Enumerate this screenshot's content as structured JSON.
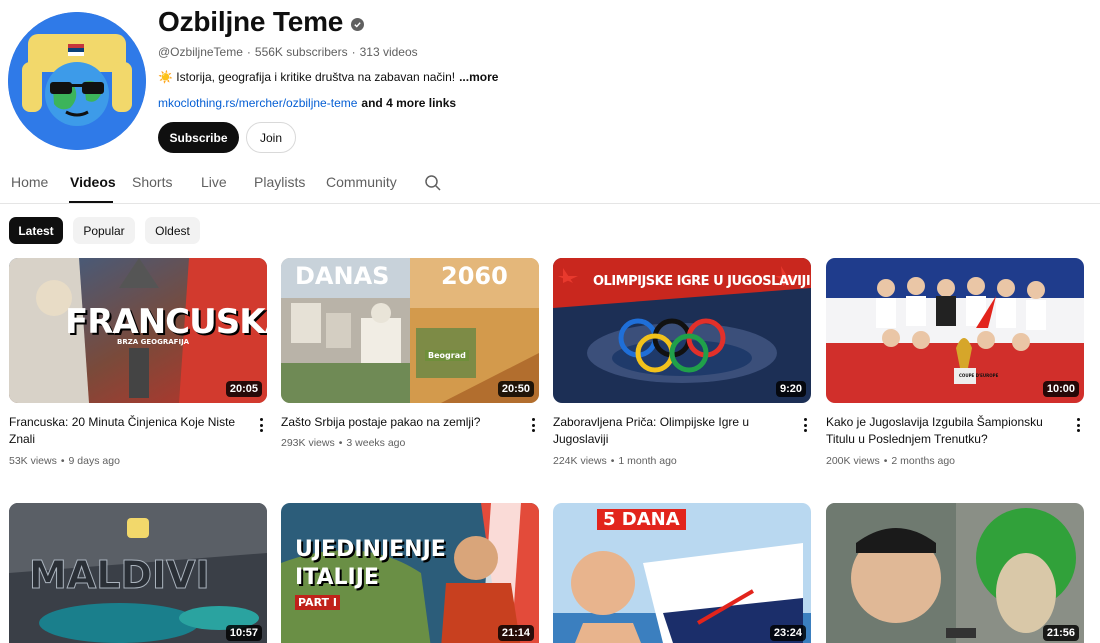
{
  "channel": {
    "name": "Ozbiljne Teme",
    "handle": "@OzbiljneTeme",
    "subscribers": "556K subscribers",
    "video_count": "313 videos",
    "separator": "·",
    "description": "☀️ Istorija, geografija i kritike društva na zabavan način!",
    "more_label": "...more",
    "link": "mkoclothing.rs/mercher/ozbiljne-teme",
    "more_links": "and 4 more links",
    "subscribe_label": "Subscribe",
    "join_label": "Join"
  },
  "tabs": [
    {
      "label": "Home"
    },
    {
      "label": "Videos"
    },
    {
      "label": "Shorts"
    },
    {
      "label": "Live"
    },
    {
      "label": "Playlists"
    },
    {
      "label": "Community"
    }
  ],
  "chips": [
    {
      "label": "Latest"
    },
    {
      "label": "Popular"
    },
    {
      "label": "Oldest"
    }
  ],
  "videos": [
    {
      "title": "Francuska: 20 Minuta Činjenica Koje Niste Znali",
      "views": "53K views",
      "age": "9 days ago",
      "duration": "20:05",
      "thumb_text": "FRANCUSKA",
      "thumb_sub": "BRZA GEOGRAFIJA"
    },
    {
      "title": "Zašto Srbija postaje pakao na zemlji?",
      "views": "293K views",
      "age": "3 weeks ago",
      "duration": "20:50",
      "thumb_text_left": "DANAS",
      "thumb_text_right": "2060",
      "thumb_sign": "Beograd"
    },
    {
      "title": "Zaboravljena Priča: Olimpijske Igre u Jugoslaviji",
      "views": "224K views",
      "age": "1 month ago",
      "duration": "9:20",
      "thumb_text": "OLIMPIJSKE IGRE U JUGOSLAVIJI"
    },
    {
      "title": "Kako je Jugoslavija Izgubila Šampionsku Titulu u Poslednjem Trenutku?",
      "views": "200K views",
      "age": "2 months ago",
      "duration": "10:00",
      "thumb_sign": "COUPE D'EUROPE"
    },
    {
      "title": "",
      "views": "",
      "age": "",
      "duration": "10:57",
      "thumb_text": "MALDIVI"
    },
    {
      "title": "",
      "views": "",
      "age": "",
      "duration": "21:14",
      "thumb_text": "UJEDINJENJE",
      "thumb_text_2": "ITALIJE",
      "thumb_badge": "PART I"
    },
    {
      "title": "",
      "views": "",
      "age": "",
      "duration": "23:24",
      "thumb_badge": "5 DANA"
    },
    {
      "title": "",
      "views": "",
      "age": "",
      "duration": "21:56"
    }
  ]
}
